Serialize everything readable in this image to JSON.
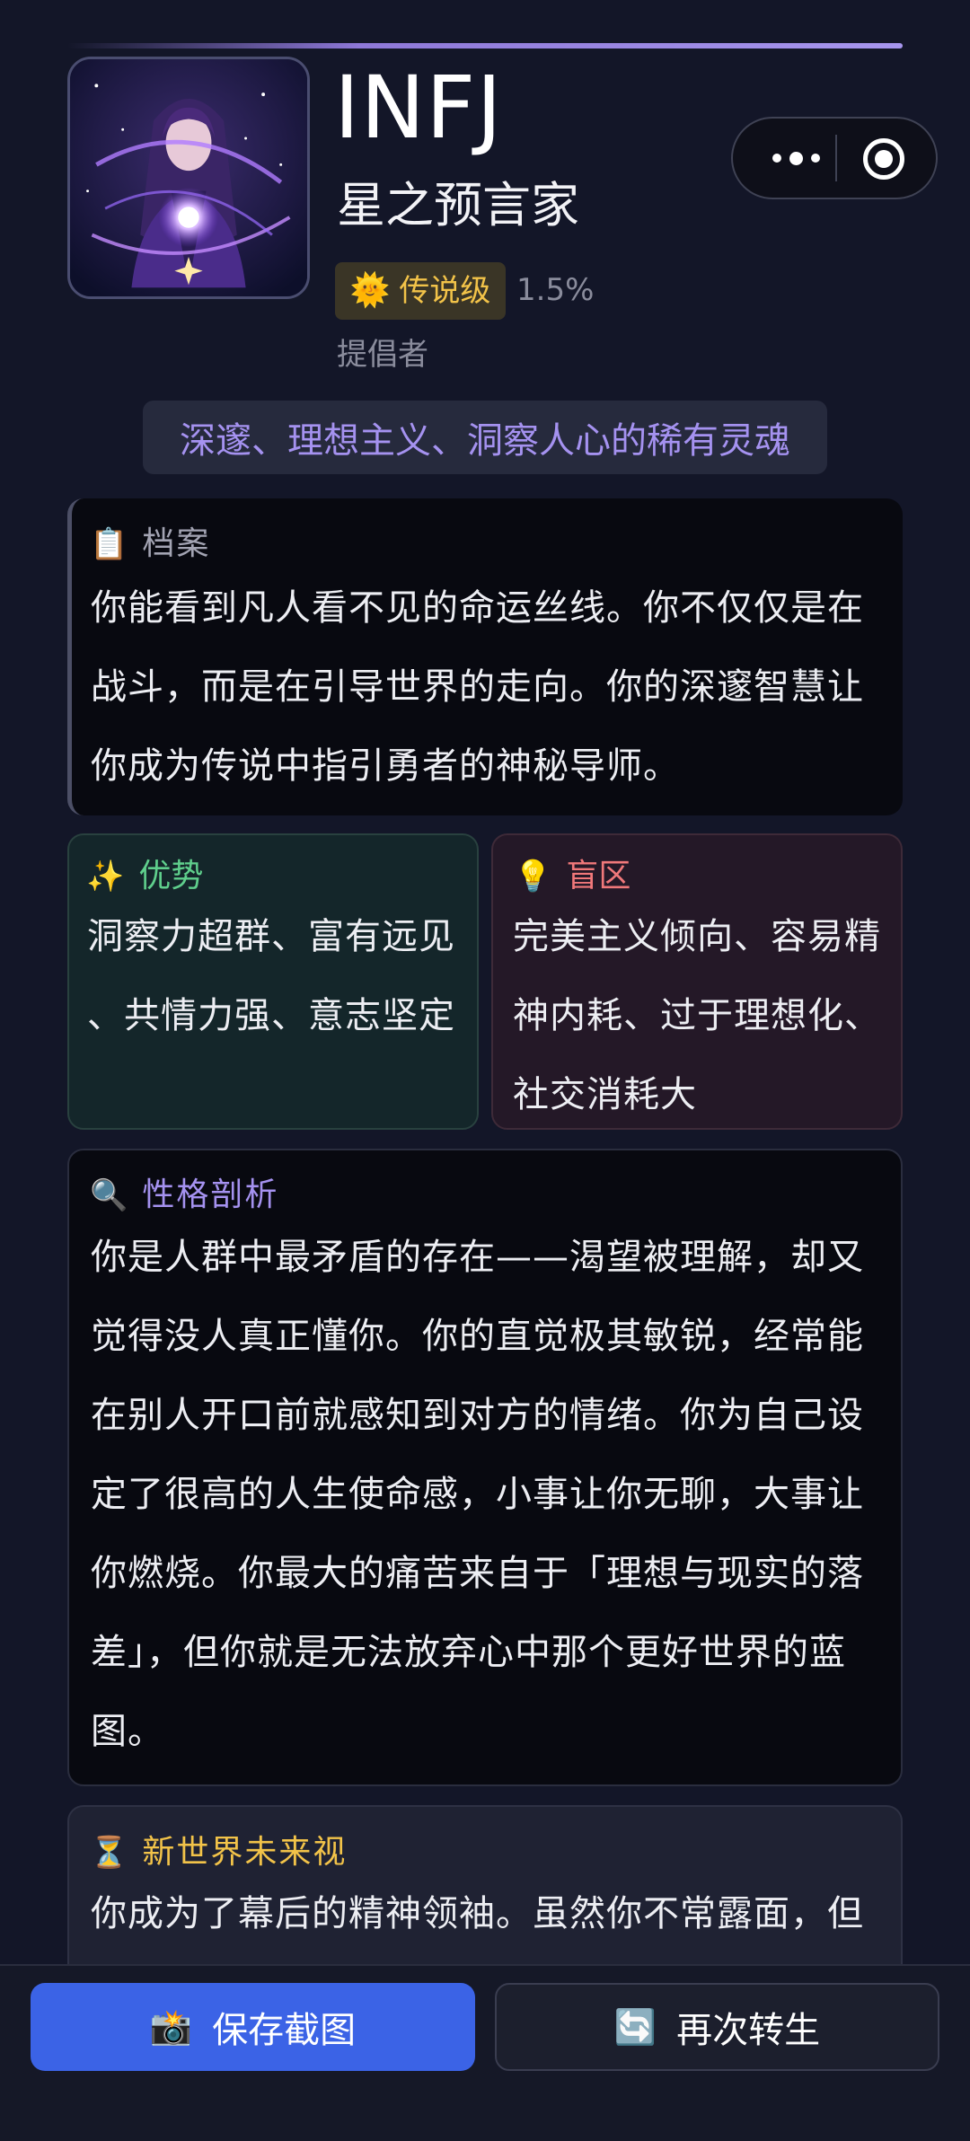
{
  "header": {
    "mbti": "INFJ",
    "title": "星之预言家",
    "rarity_badge": {
      "icon": "sun-icon",
      "label": "传说级"
    },
    "percentage": "1.5%",
    "role": "提倡者",
    "tagline": "深邃、理想主义、洞察人心的稀有灵魂"
  },
  "profile": {
    "icon": "clipboard-icon",
    "heading": "档案",
    "lines": [
      "你能看到凡人看不见的命运丝线。你不仅仅是在",
      "战斗，而是在引导世界的走向。你的深邃智慧让",
      "你成为传说中指引勇者的神秘导师。"
    ]
  },
  "strengths": {
    "icon": "sparkles-icon",
    "heading": "优势",
    "lines": [
      "洞察力超群、富有远见",
      "、共情力强、意志坚定"
    ]
  },
  "blind_spots": {
    "icon": "lightbulb-icon",
    "heading": "盲区",
    "lines": [
      "完美主义倾向、容易精",
      "神内耗、过于理想化、",
      "社交消耗大"
    ]
  },
  "analysis": {
    "icon": "magnifier-icon",
    "heading": "性格剖析",
    "lines": [
      "你是人群中最矛盾的存在——渴望被理解，却又",
      "觉得没人真正懂你。你的直觉极其敏锐，经常能",
      "在别人开口前就感知到对方的情绪。你为自己设",
      "定了很高的人生使命感，小事让你无聊，大事让",
      "你燃烧。你最大的痛苦来自于「理想与现实的落",
      "差」，但你就是无法放弃心中那个更好世界的蓝",
      "图。"
    ]
  },
  "future": {
    "icon": "hourglass-icon",
    "heading": "新世界未来视",
    "lines": [
      "你成为了幕后的精神领袖。虽然你不常露面，但"
    ]
  },
  "actions": {
    "save": {
      "icon": "camera-icon",
      "label": "保存截图"
    },
    "reincarnate": {
      "icon": "refresh-icon",
      "label": "再次转生"
    }
  },
  "colors": {
    "background": "#131628",
    "accent_purple": "#A592F0",
    "gold": "#F2C349",
    "green": "#5FCF8C",
    "red": "#F0787A",
    "primary_button": "#3B63E6"
  }
}
